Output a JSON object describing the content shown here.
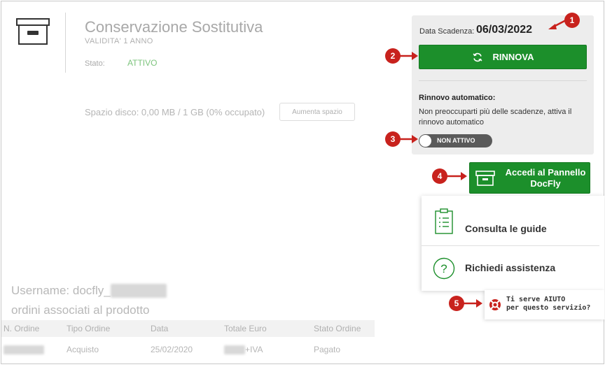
{
  "product": {
    "title": "Conservazione Sostitutiva",
    "subtitle": "VALIDITA' 1 ANNO",
    "status_label": "Stato:",
    "status_value": "ATTIVO",
    "status_color": "#7dc47d",
    "disk_usage": "Spazio disco:  0,00 MB / 1 GB (0% occupato)",
    "increase_space_label": "Aumenta spazio",
    "icon": "archive-box-icon"
  },
  "expiry": {
    "label": "Data Scadenza:",
    "date": "06/03/2022",
    "renew_label": "RINNOVA",
    "renew_icon": "refresh-icon",
    "auto_renew_title": "Rinnovo automatico:",
    "auto_renew_description": "Non preoccuparti più delle scadenze, attiva il rinnovo automatico",
    "toggle_label": "NON ATTIVO",
    "toggle_on": false
  },
  "docfly": {
    "label": "Accedi al Pannello DocFly",
    "icon": "archive-box-icon"
  },
  "help": {
    "guides_label": "Consulta le guide",
    "guides_icon": "clipboard-list-icon",
    "support_label": "Richiedi assistenza",
    "support_icon": "question-circle-icon",
    "aiuto_line1": "Ti serve AIUTO",
    "aiuto_line2": "per questo servizio?",
    "aiuto_icon": "lifebuoy-icon"
  },
  "account": {
    "username_prefix": "Username: docfly_",
    "orders_title": "ordini associati al prodotto"
  },
  "orders": {
    "headers": [
      "N. Ordine",
      "Tipo Ordine",
      "Data",
      "Totale Euro",
      "Stato Ordine"
    ],
    "rows": [
      {
        "tipo": "Acquisto",
        "data": "25/02/2020",
        "totale_suffix": "+IVA",
        "stato": "Pagato"
      }
    ]
  },
  "markers": [
    "1",
    "2",
    "3",
    "4",
    "5"
  ],
  "colors": {
    "primary_green": "#1c8f2b",
    "marker_red": "#c8221d",
    "panel_gray": "#ededed"
  }
}
